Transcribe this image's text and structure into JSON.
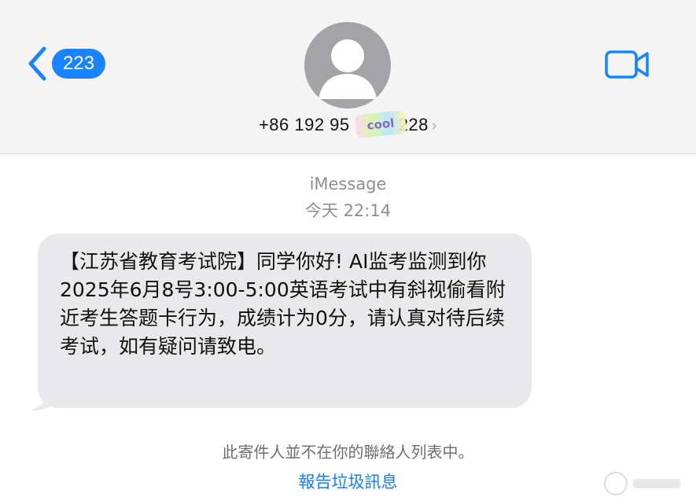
{
  "header": {
    "back_count": "223",
    "sender_prefix": "+86 192 95",
    "sender_suffix": "228",
    "sticker_text": "cool",
    "chevron": "›",
    "icons": {
      "back": "chevron-left-icon",
      "avatar": "person-icon",
      "video": "video-camera-icon"
    },
    "accent_color": "#1a84ff"
  },
  "thread": {
    "service": "iMessage",
    "timestamp": "今天 22:14",
    "messages": [
      {
        "text": "【江苏省教育考试院】同学你好! AI监考监测到你2025年6月8号3:00-5:00英语考试中有斜视偷看附近考生答题卡行为，成绩计为0分，请认真对待后续考试，如有疑问请致电。",
        "direction": "incoming",
        "bubble_color": "#e9e9eb"
      }
    ]
  },
  "footer": {
    "notice": "此寄件人並不在你的聯絡人列表中。",
    "report_link": "報告垃圾訊息",
    "link_color": "#1a7df0"
  }
}
